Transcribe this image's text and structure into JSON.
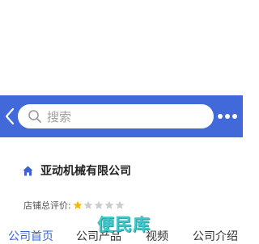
{
  "colors": {
    "header": "#4169d9",
    "tab_active": "#3b63d4",
    "star_filled": "#f5b800",
    "star_empty": "#cccccc",
    "watermark": "#2fc4c4"
  },
  "header": {
    "back_icon": "chevron-left-icon",
    "search_placeholder": "搜索",
    "search_icon": "search-icon",
    "more_icon": "more-dots-icon"
  },
  "shop": {
    "icon": "home-icon",
    "name": "亚动机械有限公司"
  },
  "rating": {
    "label": "店铺总评价:",
    "stars_filled": 1,
    "stars_total": 5
  },
  "tabs": [
    {
      "label": "公司首页",
      "active": true
    },
    {
      "label": "公司产品",
      "active": false
    },
    {
      "label": "视频",
      "active": false
    },
    {
      "label": "公司介绍",
      "active": false
    }
  ],
  "watermark": "便民库"
}
